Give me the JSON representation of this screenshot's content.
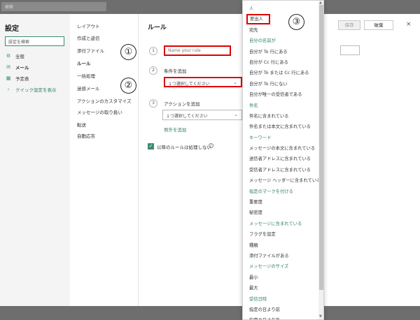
{
  "topbar": {
    "search": "検索"
  },
  "settings": {
    "title": "設定",
    "search_placeholder": "設定を検索",
    "nav": [
      {
        "icon": "gear-icon",
        "glyph": "⚙",
        "label": "全般"
      },
      {
        "icon": "mail-icon",
        "glyph": "✉",
        "label": "メール"
      },
      {
        "icon": "calendar-icon",
        "glyph": "▦",
        "label": "予定表"
      }
    ],
    "quick_settings": "クイック設定を表示"
  },
  "mail_menu": [
    "レイアウト",
    "作成と返信",
    "添付ファイル",
    "ルール",
    "一括処理",
    "迷惑メール",
    "アクションのカスタマイズ",
    "メッセージの取り扱い",
    "転送",
    "自動応答"
  ],
  "rule": {
    "title": "ルール",
    "save": "保存",
    "discard": "破棄",
    "close": "×",
    "name_placeholder": "Name your rule",
    "step1": "1",
    "step2": "2",
    "step3": "3",
    "add_condition": "条件を追加",
    "condition_select": "１つ選択してください",
    "add_action": "アクションを追加",
    "action_select": "１つ選択してください",
    "add_exception": "例外を追加",
    "stop_processing": "以降のルールは処理しない",
    "info": "i"
  },
  "annotations": {
    "one": "①",
    "two": "②",
    "three": "③"
  },
  "dropdown": {
    "items": [
      {
        "label": "人",
        "group": true
      },
      {
        "label": "差出人",
        "group": false,
        "selected": true
      },
      {
        "label": "宛先",
        "group": false
      },
      {
        "label": "自分の名前が",
        "group": true
      },
      {
        "label": "自分が To 行にある",
        "group": false
      },
      {
        "label": "自分が Cc 行にある",
        "group": false
      },
      {
        "label": "自分が To または Cc 行にある",
        "group": false
      },
      {
        "label": "自分が To 行にない",
        "group": false
      },
      {
        "label": "自分が唯一の受信者である",
        "group": false
      },
      {
        "label": "件名",
        "group": true
      },
      {
        "label": "件名に含まれている",
        "group": false
      },
      {
        "label": "件名または本文に含まれている",
        "group": false
      },
      {
        "label": "キーワード",
        "group": true
      },
      {
        "label": "メッセージの本文に含まれている",
        "group": false
      },
      {
        "label": "送信者アドレスに含まれている",
        "group": false
      },
      {
        "label": "受信者アドレスに含まれている",
        "group": false
      },
      {
        "label": "メッセージ ヘッダーに含まれている",
        "group": false
      },
      {
        "label": "指定のマークを付ける",
        "group": true
      },
      {
        "label": "重要度",
        "group": false
      },
      {
        "label": "秘密度",
        "group": false
      },
      {
        "label": "メッセージに含まれている",
        "group": true
      },
      {
        "label": "フラグを設定",
        "group": false
      },
      {
        "label": "種類",
        "group": false
      },
      {
        "label": "添付ファイルがある",
        "group": false
      },
      {
        "label": "メッセージのサイズ",
        "group": true
      },
      {
        "label": "最小",
        "group": false
      },
      {
        "label": "最大",
        "group": false
      },
      {
        "label": "受信日時",
        "group": true
      },
      {
        "label": "指定の日より前",
        "group": false
      },
      {
        "label": "指定の日より後",
        "group": false
      }
    ]
  },
  "bottombar": {
    "left": "",
    "right": ""
  },
  "colors": {
    "accent": "#3a8c6e",
    "highlight": "#e00000"
  }
}
